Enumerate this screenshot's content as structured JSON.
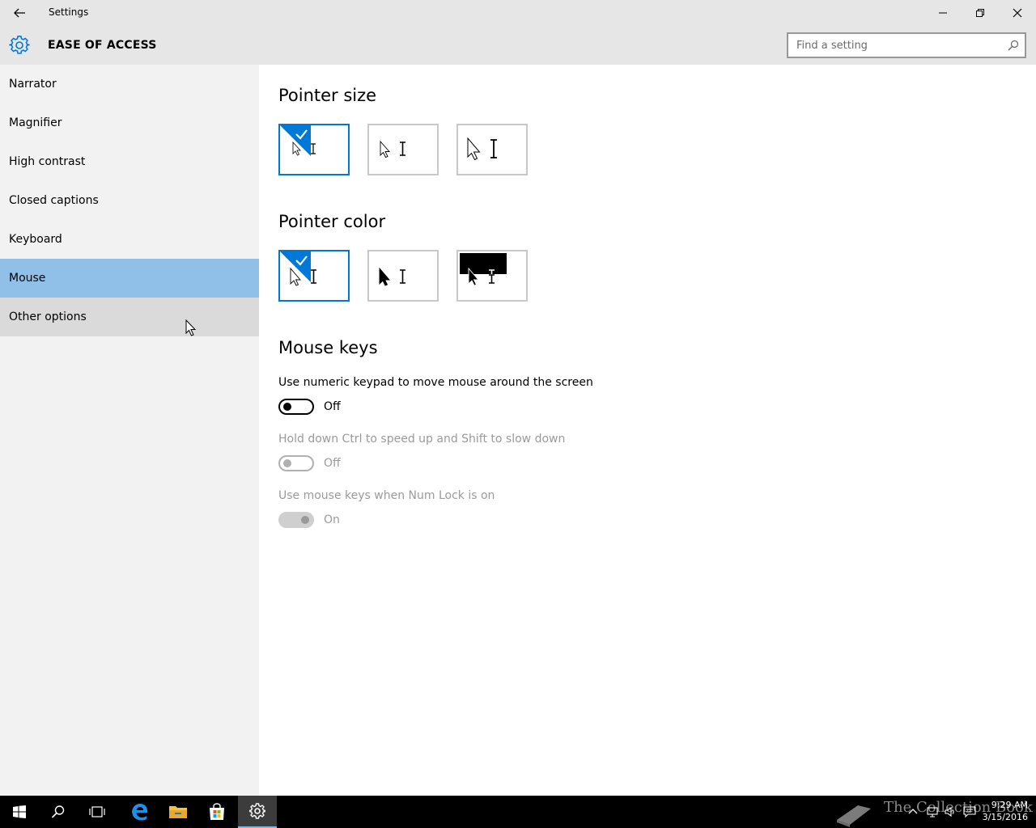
{
  "window": {
    "title": "Settings"
  },
  "header": {
    "section_title": "EASE OF ACCESS",
    "search_placeholder": "Find a setting"
  },
  "sidebar": {
    "items": [
      {
        "label": "Narrator"
      },
      {
        "label": "Magnifier"
      },
      {
        "label": "High contrast"
      },
      {
        "label": "Closed captions"
      },
      {
        "label": "Keyboard"
      },
      {
        "label": "Mouse",
        "selected": true
      },
      {
        "label": "Other options",
        "hovered": true
      }
    ]
  },
  "main": {
    "pointer_size": {
      "heading": "Pointer size",
      "options": [
        "small",
        "medium",
        "large"
      ],
      "selected_index": 0
    },
    "pointer_color": {
      "heading": "Pointer color",
      "options": [
        "white",
        "black",
        "inverted"
      ],
      "selected_index": 0
    },
    "mouse_keys": {
      "heading": "Mouse keys",
      "settings": [
        {
          "label": "Use numeric keypad to move mouse around the screen",
          "state": "Off",
          "enabled": true
        },
        {
          "label": "Hold down Ctrl to speed up and Shift to slow down",
          "state": "Off",
          "enabled": false
        },
        {
          "label": "Use mouse keys when Num Lock is on",
          "state": "On",
          "enabled": false
        }
      ]
    }
  },
  "taskbar": {
    "pinned": [
      "start-icon",
      "search-icon",
      "task-view-icon",
      "edge-icon",
      "file-explorer-icon",
      "store-icon",
      "settings-icon"
    ],
    "active": "settings-icon",
    "watermark": "The Collection Book",
    "time": "9:29 AM",
    "date": "3/15/2016"
  },
  "colors": {
    "accent": "#0078d7",
    "selected_nav": "#90bfe8",
    "chrome": "#e6e6e6",
    "sidebar": "#f2f2f2"
  }
}
